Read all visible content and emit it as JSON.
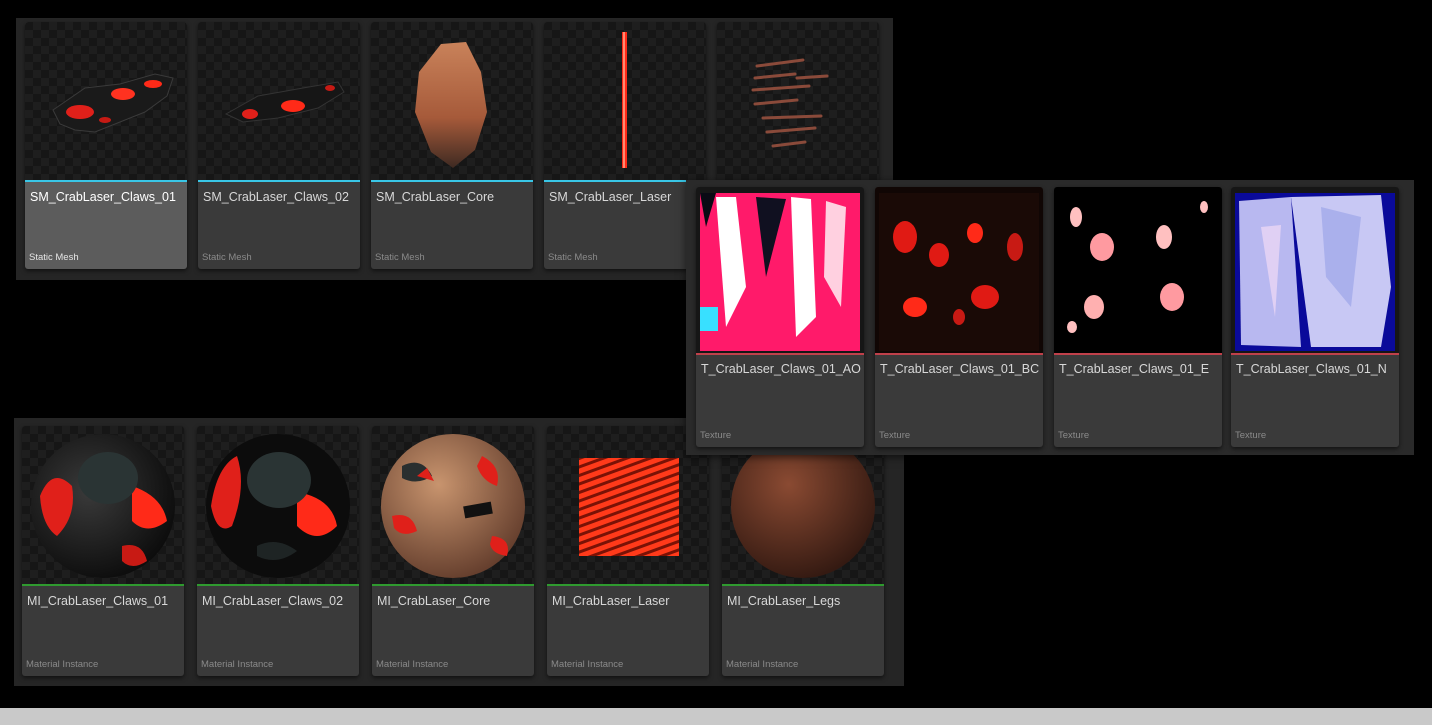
{
  "panels": {
    "static_meshes": {
      "type_color": "#39c6e6",
      "items": [
        {
          "name": "SM_CrabLaser_Claws_01",
          "type": "Static Mesh",
          "selected": true
        },
        {
          "name": "SM_CrabLaser_Claws_02",
          "type": "Static Mesh"
        },
        {
          "name": "SM_CrabLaser_Core",
          "type": "Static Mesh"
        },
        {
          "name": "SM_CrabLaser_Laser",
          "type": "Static Mesh"
        },
        {
          "name": "",
          "type": ""
        }
      ]
    },
    "textures": {
      "type_color": "#c0404a",
      "items": [
        {
          "name": "T_CrabLaser_Claws_01_AO",
          "type": "Texture"
        },
        {
          "name": "T_CrabLaser_Claws_01_BC",
          "type": "Texture"
        },
        {
          "name": "T_CrabLaser_Claws_01_E",
          "type": "Texture"
        },
        {
          "name": "T_CrabLaser_Claws_01_N",
          "type": "Texture"
        }
      ]
    },
    "material_instances": {
      "type_color": "#2f9a2f",
      "items": [
        {
          "name": "MI_CrabLaser_Claws_01",
          "type": "Material Instance"
        },
        {
          "name": "MI_CrabLaser_Claws_02",
          "type": "Material Instance"
        },
        {
          "name": "MI_CrabLaser_Core",
          "type": "Material Instance"
        },
        {
          "name": "MI_CrabLaser_Laser",
          "type": "Material Instance"
        },
        {
          "name": "MI_CrabLaser_Legs",
          "type": "Material Instance"
        }
      ]
    }
  }
}
